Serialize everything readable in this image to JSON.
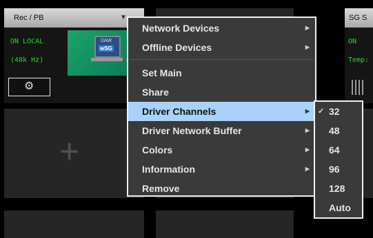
{
  "cards": {
    "left": {
      "title": "Rec / PB",
      "status": "ON  LOCAL",
      "rate": "(48k Hz)",
      "device_screen_top": "DAW",
      "device_screen_logo": "wSG"
    },
    "right": {
      "title": "SG S",
      "status": "ON",
      "temp": "Temp:"
    }
  },
  "add_tile": {
    "symbol": "+"
  },
  "context_menu": {
    "items": [
      {
        "label": "Network Devices",
        "has_submenu": true
      },
      {
        "label": "Offline Devices",
        "has_submenu": true
      },
      {
        "label": "Set Main",
        "has_submenu": false
      },
      {
        "label": "Share",
        "has_submenu": false
      },
      {
        "label": "Driver Channels",
        "has_submenu": true,
        "highlighted": true
      },
      {
        "label": "Driver Network Buffer",
        "has_submenu": true
      },
      {
        "label": "Colors",
        "has_submenu": true
      },
      {
        "label": "Information",
        "has_submenu": true
      },
      {
        "label": "Remove",
        "has_submenu": false
      }
    ],
    "highlight_color": "#a7d2fb"
  },
  "submenu": {
    "items": [
      {
        "label": "32",
        "checked": true
      },
      {
        "label": "48",
        "checked": false
      },
      {
        "label": "64",
        "checked": false
      },
      {
        "label": "96",
        "checked": false
      },
      {
        "label": "128",
        "checked": false
      },
      {
        "label": "Auto",
        "checked": false
      }
    ]
  },
  "colors": {
    "status_green": "#22dd22",
    "menu_bg": "#3a3a3a"
  }
}
